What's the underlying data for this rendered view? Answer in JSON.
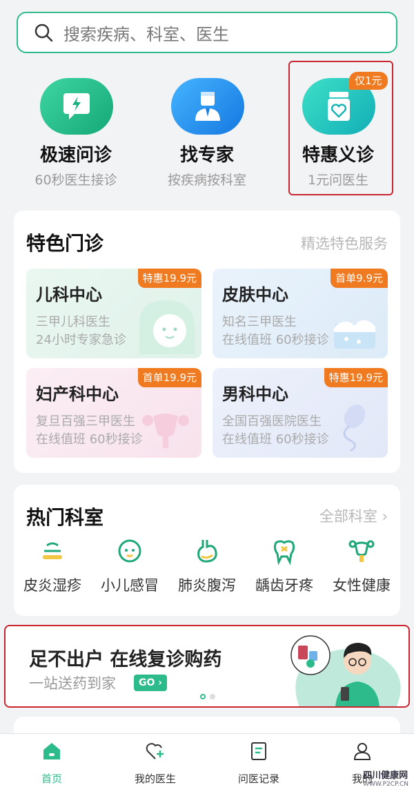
{
  "search": {
    "placeholder": "搜索疾病、科室、医生"
  },
  "quick_entries": [
    {
      "title": "极速问诊",
      "subtitle": "60秒医生接诊",
      "icon": "chat-lightning-icon",
      "color": "#1fbf8a"
    },
    {
      "title": "找专家",
      "subtitle": "按疾病按科室",
      "icon": "doctor-icon",
      "color": "#1f8ff0"
    },
    {
      "title": "特惠义诊",
      "subtitle": "1元问医生",
      "icon": "medicine-jar-icon",
      "color": "#1ec3c0",
      "tag": "仅1元"
    }
  ],
  "featured": {
    "title": "特色门诊",
    "more": "精选特色服务",
    "clinics": [
      {
        "name": "儿科中心",
        "line1": "三甲儿科医生",
        "line2": "24小时专家急诊",
        "badge": "特惠19.9元"
      },
      {
        "name": "皮肤中心",
        "line1": "知名三甲医生",
        "line2": "在线值班 60秒接诊",
        "badge": "首单9.9元"
      },
      {
        "name": "妇产科中心",
        "line1": "复旦百强三甲医生",
        "line2": "在线值班 60秒接诊",
        "badge": "首单19.9元"
      },
      {
        "name": "男科中心",
        "line1": "全国百强医院医生",
        "line2": "在线值班 60秒接诊",
        "badge": "特惠19.9元"
      }
    ]
  },
  "departments": {
    "title": "热门科室",
    "more": "全部科室 ",
    "items": [
      {
        "label": "皮炎湿疹",
        "icon": "skin-icon"
      },
      {
        "label": "小儿感冒",
        "icon": "baby-face-icon"
      },
      {
        "label": "肺炎腹泻",
        "icon": "stomach-icon"
      },
      {
        "label": "龋齿牙疼",
        "icon": "tooth-icon"
      },
      {
        "label": "女性健康",
        "icon": "uterus-icon"
      }
    ]
  },
  "banner": {
    "title": "足不出户 在线复诊购药",
    "subtitle": "一站送药到家",
    "cta": "GO"
  },
  "tabbar": [
    {
      "label": "首页",
      "icon": "home-icon",
      "active": true
    },
    {
      "label": "我的医生",
      "icon": "heart-plus-icon",
      "active": false
    },
    {
      "label": "问医记录",
      "icon": "record-icon",
      "active": false
    },
    {
      "label": "我的",
      "icon": "user-icon",
      "active": false
    }
  ],
  "watermark": {
    "name": "四川健康网",
    "url": "WWW.P2CP.CN"
  },
  "colors": {
    "accent": "#2dbb8c",
    "badge": "#f07a1f",
    "highlight": "#c9242f"
  }
}
